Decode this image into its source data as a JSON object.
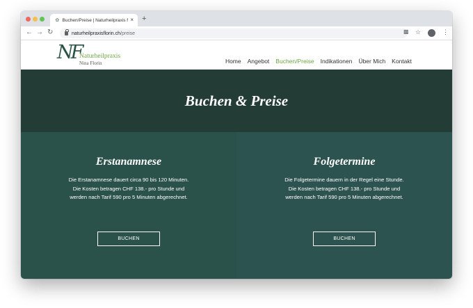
{
  "browser": {
    "tab_title": "Buchen/Preise | Naturheilpraxis Nina Florin",
    "tab_close": "×",
    "new_tab": "+",
    "url_host": "naturheilpraxisflorin.ch",
    "url_path": "/preise",
    "icons": [
      "back-icon",
      "forward-icon",
      "reload-icon",
      "lock-icon",
      "translate-icon",
      "star-icon",
      "profile-icon",
      "menu-icon"
    ]
  },
  "site": {
    "logo_mark": "NF",
    "logo_name": "Naturheilpraxis",
    "logo_sub": "Nina Florin",
    "nav": [
      {
        "label": "Home"
      },
      {
        "label": "Angebot"
      },
      {
        "label": "Buchen/Preise",
        "active": true
      },
      {
        "label": "Indikationen"
      },
      {
        "label": "Über Mich"
      },
      {
        "label": "Kontakt"
      }
    ],
    "hero_title": "Buchen & Preise",
    "columns": [
      {
        "title": "Erstanamnese",
        "text": "Die Erstanamnese dauert circa 90 bis 120 Minuten. Die Kosten betragen CHF 138.- pro Stunde und werden nach Tarif 590 pro 5 Minuten abgerechnet.",
        "button": "BUCHEN"
      },
      {
        "title": "Folgetermine",
        "text": "Die Folgetermine dauern in der Regel eine Stunde. Die Kosten betragen CHF 138.- pro Stunde und werden nach Tarif 590 pro 5 Minuten abgerechnet.",
        "button": "BUCHEN"
      }
    ]
  },
  "colors": {
    "brand_green": "#6aa443",
    "hero_bg": "#233d36",
    "column_left_bg": "#2a524a",
    "column_right_bg": "#2d5350"
  }
}
